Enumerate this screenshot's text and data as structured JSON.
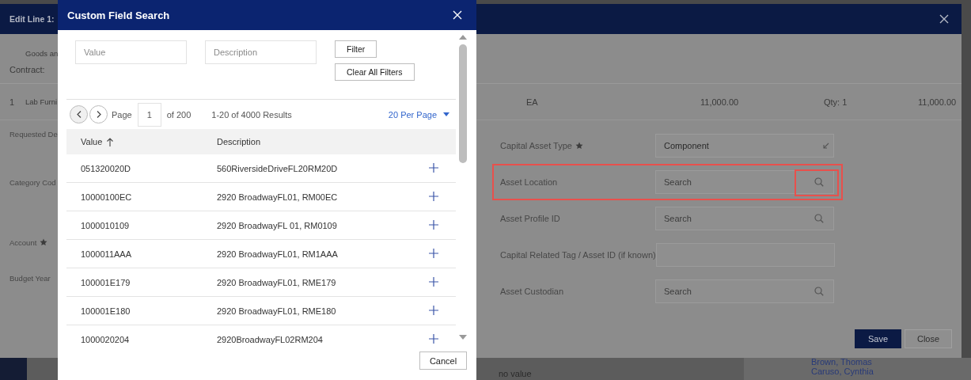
{
  "background_page": {
    "texts": [
      {
        "kind": "cell",
        "text": "no value"
      },
      {
        "kind": "person",
        "text": "Brown, Thomas"
      },
      {
        "kind": "person",
        "text": "Caruso, Cynthia"
      }
    ]
  },
  "edit_dialog": {
    "title": "Edit Line 1:",
    "goods_text": "Goods an",
    "contract_label": "Contract:",
    "line": {
      "number": "1",
      "item": "Lab Furni",
      "unit": "EA",
      "price": "11,000.00",
      "qty": "Qty: 1",
      "total": "11,000.00"
    },
    "left_labels": [
      {
        "label": "Requested De"
      },
      {
        "label": "Category Cod"
      },
      {
        "label": "Account",
        "required": true
      },
      {
        "label": "Budget Year"
      }
    ],
    "fields": [
      {
        "label": "Capital Asset Type",
        "required": true,
        "kind": "select",
        "value": "Component",
        "highlighted": false
      },
      {
        "label": "Asset Location",
        "required": false,
        "kind": "search",
        "placeholder": "Search",
        "highlighted": true
      },
      {
        "label": "Asset Profile ID",
        "required": false,
        "kind": "search",
        "placeholder": "Search",
        "highlighted": false
      },
      {
        "label": "Capital Related Tag / Asset ID (if known)",
        "required": false,
        "kind": "text",
        "highlighted": false
      },
      {
        "label": "Asset Custodian",
        "required": false,
        "kind": "search",
        "placeholder": "Search",
        "highlighted": false
      }
    ],
    "buttons": [
      {
        "label": "Save",
        "kind": "primary"
      },
      {
        "label": "Close",
        "kind": "secondary"
      }
    ]
  },
  "search_dialog": {
    "title": "Custom Field Search",
    "filters": [
      {
        "placeholder": "Value"
      },
      {
        "placeholder": "Description"
      }
    ],
    "filter_button": "Filter",
    "clear_button": "Clear All Filters",
    "pagination": {
      "page_label": "Page",
      "page": "1",
      "of": "of 200",
      "results": "1-20 of 4000 Results",
      "per_page": "20 Per Page"
    },
    "table": {
      "columns": [
        {
          "label": "Value",
          "sorted": true
        },
        {
          "label": "Description",
          "sorted": false
        }
      ],
      "rows": [
        {
          "value": "051320020D",
          "description": "560RiversideDriveFL20RM20D"
        },
        {
          "value": "10000100EC",
          "description": "2920 BroadwayFL01, RM00EC"
        },
        {
          "value": "1000010109",
          "description": "2920 BroadwayFL 01, RM0109"
        },
        {
          "value": "1000011AAA",
          "description": "2920 BroadwayFL01, RM1AAA"
        },
        {
          "value": "100001E179",
          "description": "2920 BroadwayFL01, RME179"
        },
        {
          "value": "100001E180",
          "description": "2920 BroadwayFL01, RME180"
        },
        {
          "value": "1000020204",
          "description": "2920BroadwayFL02RM204"
        }
      ]
    },
    "cancel_button": "Cancel"
  }
}
